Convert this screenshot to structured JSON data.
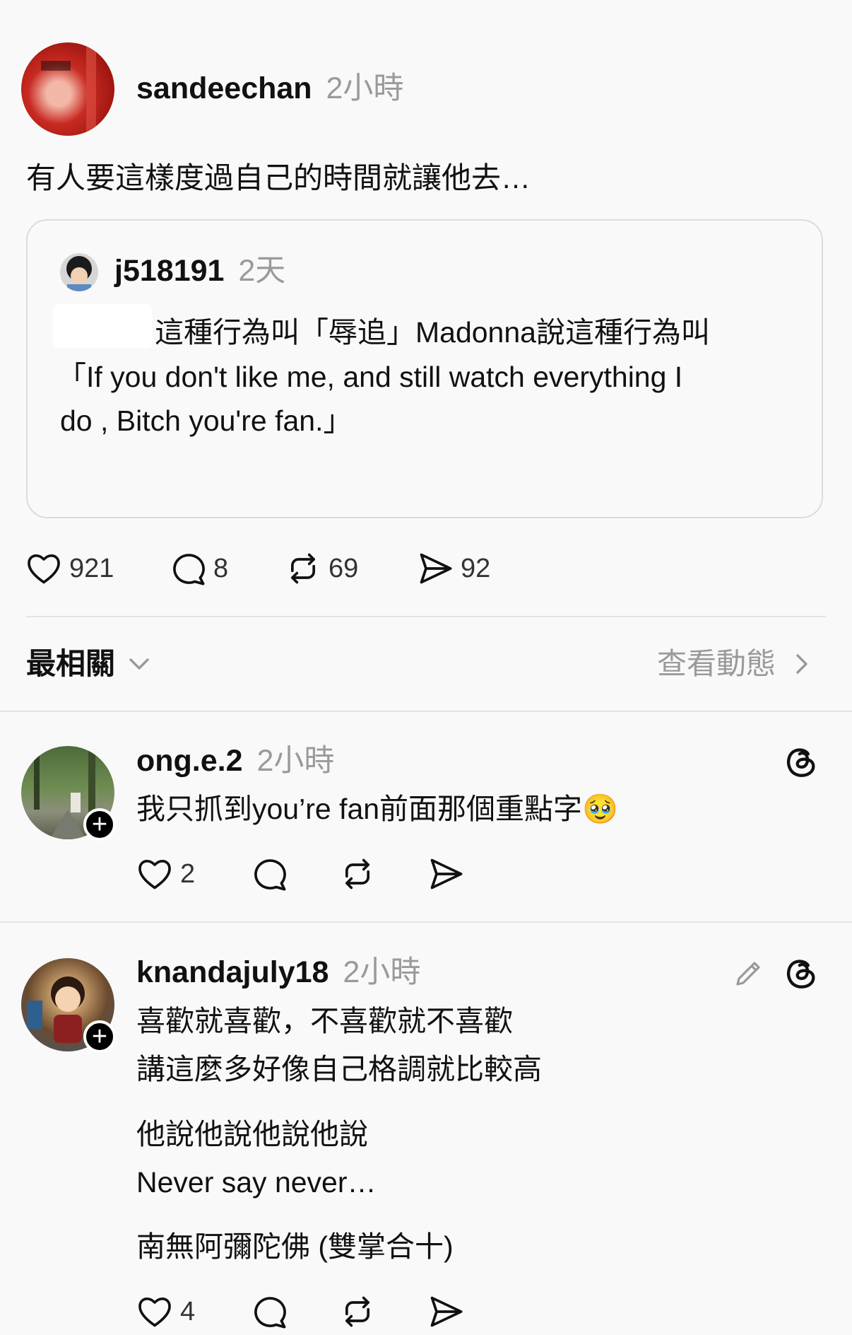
{
  "post": {
    "username": "sandeechan",
    "time": "2小時",
    "text": "有人要這樣度過自己的時間就讓他去…",
    "quote": {
      "username": "j518191",
      "time": "2天",
      "line1": "這種行為叫「辱追」Madonna說這種行為叫",
      "line2": "「If you don't like me, and still watch everything I",
      "line3": "do , Bitch you're fan.」"
    },
    "stats": {
      "likes": "921",
      "comments": "8",
      "reposts": "69",
      "shares": "92"
    }
  },
  "replies_bar": {
    "sort_label": "最相關",
    "activity_label": "查看動態"
  },
  "replies": [
    {
      "username": "ong.e.2",
      "time": "2小時",
      "text": "我只抓到you’re fan前面那個重點字🥹",
      "likes": "2"
    },
    {
      "username": "knandajuly18",
      "time": "2小時",
      "lines": [
        "喜歡就喜歡，不喜歡就不喜歡",
        "講這麼多好像自己格調就比較高",
        "他說他說他說他說",
        "Never say never…",
        "南無阿彌陀佛 (雙掌合十)"
      ],
      "likes": "4"
    }
  ],
  "icons": {
    "like": "heart-icon",
    "comment": "comment-bubble-icon",
    "repost": "repost-icon",
    "share": "send-icon",
    "threads": "threads-logo-icon",
    "edit": "pencil-icon",
    "chevron_down": "chevron-down-icon",
    "chevron_right": "chevron-right-icon"
  }
}
